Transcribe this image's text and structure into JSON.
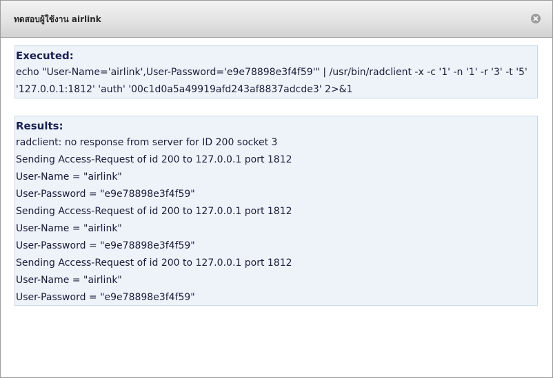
{
  "dialog": {
    "title": "ทดสอบผู้ใช้งาน airlink",
    "close_icon": "close-icon"
  },
  "executed": {
    "heading": "Executed:",
    "command": "echo \"User-Name='airlink',User-Password='e9e78898e3f4f59'\" | /usr/bin/radclient -x -c '1' -n '1' -r '3' -t '5' '127.0.0.1:1812' 'auth' '00c1d0a5a49919afd243af8837adcde3' 2>&1"
  },
  "results": {
    "heading": "Results:",
    "lines": [
      "radclient: no response from server for ID 200 socket 3",
      "Sending Access-Request of id 200 to 127.0.0.1 port 1812",
      "User-Name = \"airlink\"",
      "User-Password = \"e9e78898e3f4f59\"",
      "Sending Access-Request of id 200 to 127.0.0.1 port 1812",
      "User-Name = \"airlink\"",
      "User-Password = \"e9e78898e3f4f59\"",
      "Sending Access-Request of id 200 to 127.0.0.1 port 1812",
      "User-Name = \"airlink\"",
      "User-Password = \"e9e78898e3f4f59\""
    ]
  }
}
